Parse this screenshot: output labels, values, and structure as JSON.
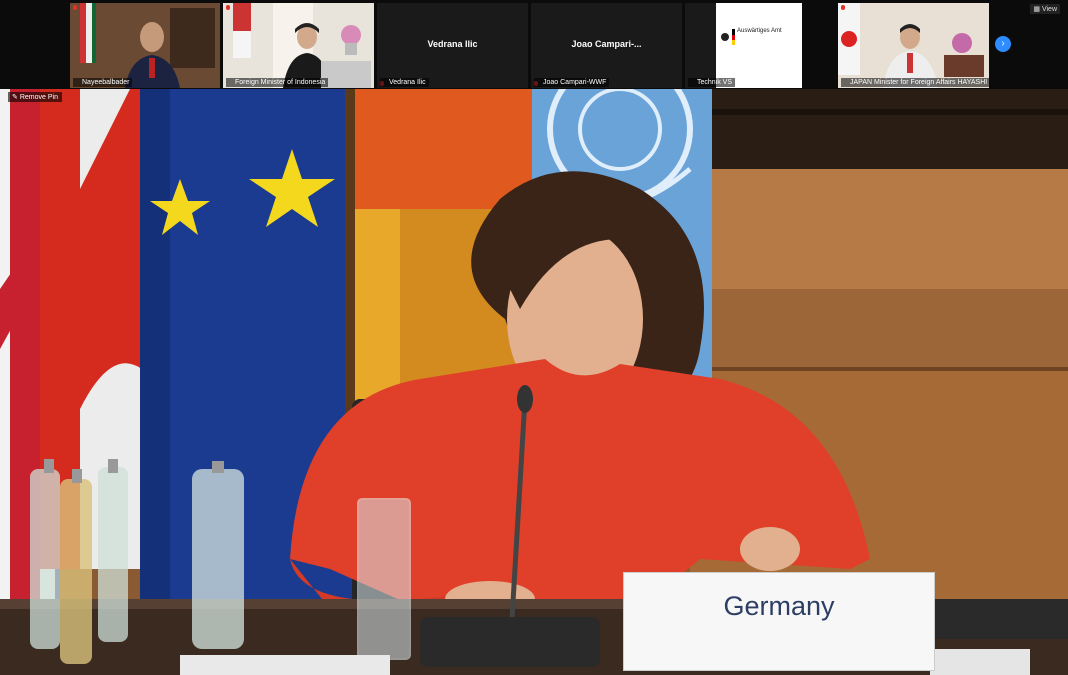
{
  "participants": [
    {
      "name": "Nayeebalbader",
      "video": true
    },
    {
      "name": "Foreign Minister of Indonesia",
      "video": true
    },
    {
      "name": "Vedrana Ilic",
      "video": false,
      "display": "Vedrana Ilic"
    },
    {
      "name": "Joao Campari-WWF",
      "video": false,
      "display": "Joao  Campari-..."
    },
    {
      "name": "Technik VS",
      "video": true,
      "logo_text": "Auswärtiges Amt"
    },
    {
      "name": "JAPAN Minister for Foreign Affairs HAYASHI",
      "video": true
    }
  ],
  "view_label": "View",
  "remove_pin_label": "Remove Pin",
  "nameplate": "Germany",
  "colors": {
    "zoom_blue": "#2d8cff",
    "mic_red": "#e0322b",
    "shirt": "#e0402a"
  }
}
